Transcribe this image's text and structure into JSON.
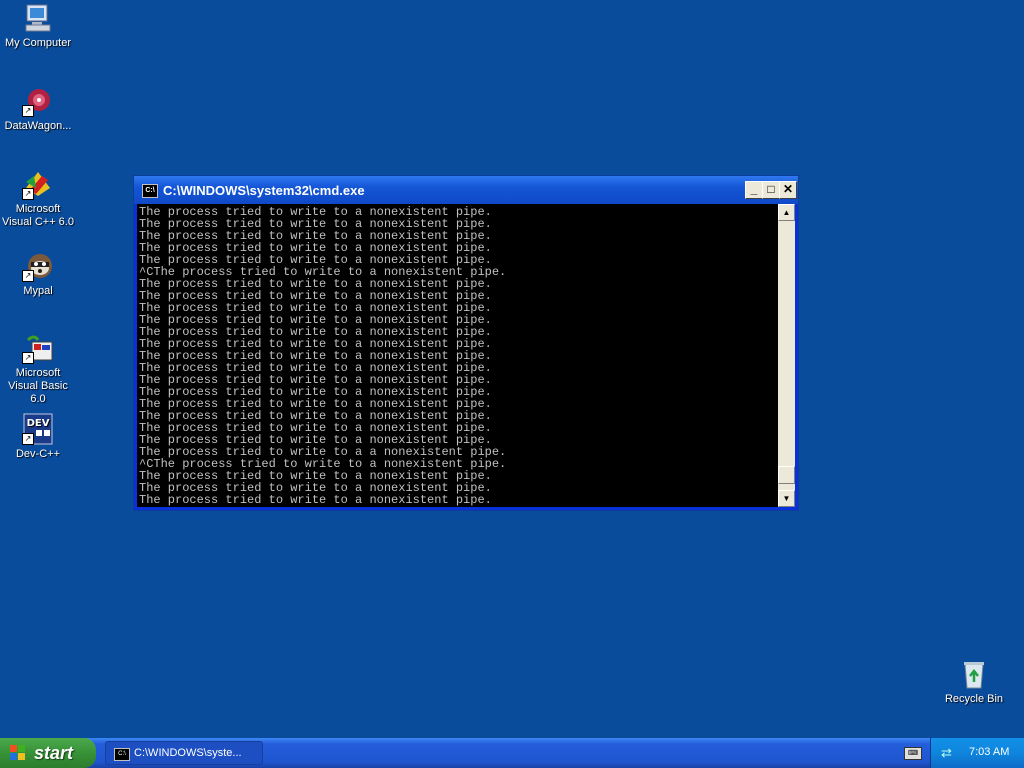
{
  "desktop": {
    "icons": [
      {
        "label": "My Computer",
        "icon": "my-computer-icon"
      },
      {
        "label": "DataWagon...",
        "icon": "datawagon-icon"
      },
      {
        "label": "Microsoft Visual C++ 6.0",
        "icon": "visual-cpp-icon"
      },
      {
        "label": "Mypal",
        "icon": "mypal-icon"
      },
      {
        "label": "Microsoft Visual Basic 6.0",
        "icon": "visual-basic-icon"
      },
      {
        "label": "Dev-C++",
        "icon": "dev-cpp-icon"
      },
      {
        "label": "Recycle Bin",
        "icon": "recycle-bin-icon"
      }
    ]
  },
  "window": {
    "title": "C:\\WINDOWS\\system32\\cmd.exe",
    "icon_text": "C:\\",
    "minimize": "_",
    "maximize": "□",
    "close": "✕",
    "console_lines": [
      "The process tried to write to a nonexistent pipe.",
      "The process tried to write to a nonexistent pipe.",
      "The process tried to write to a nonexistent pipe.",
      "The process tried to write to a nonexistent pipe.",
      "The process tried to write to a nonexistent pipe.",
      "^CThe process tried to write to a nonexistent pipe.",
      "The process tried to write to a nonexistent pipe.",
      "The process tried to write to a nonexistent pipe.",
      "The process tried to write to a nonexistent pipe.",
      "The process tried to write to a nonexistent pipe.",
      "The process tried to write to a nonexistent pipe.",
      "The process tried to write to a nonexistent pipe.",
      "The process tried to write to a nonexistent pipe.",
      "The process tried to write to a nonexistent pipe.",
      "The process tried to write to a nonexistent pipe.",
      "The process tried to write to a nonexistent pipe.",
      "The process tried to write to a nonexistent pipe.",
      "The process tried to write to a nonexistent pipe.",
      "The process tried to write to a nonexistent pipe.",
      "The process tried to write to a nonexistent pipe.",
      "The process tried to write to a a nonexistent pipe.",
      "^CThe process tried to write to a nonexistent pipe.",
      "The process tried to write to a nonexistent pipe.",
      "The process tried to write to a nonexistent pipe.",
      "The process tried to write to a nonexistent pipe."
    ]
  },
  "taskbar": {
    "start_label": "start",
    "task_label": "C:\\WINDOWS\\syste...",
    "keyboard_icon": "keyboard-icon",
    "clock": "7:03 AM"
  }
}
